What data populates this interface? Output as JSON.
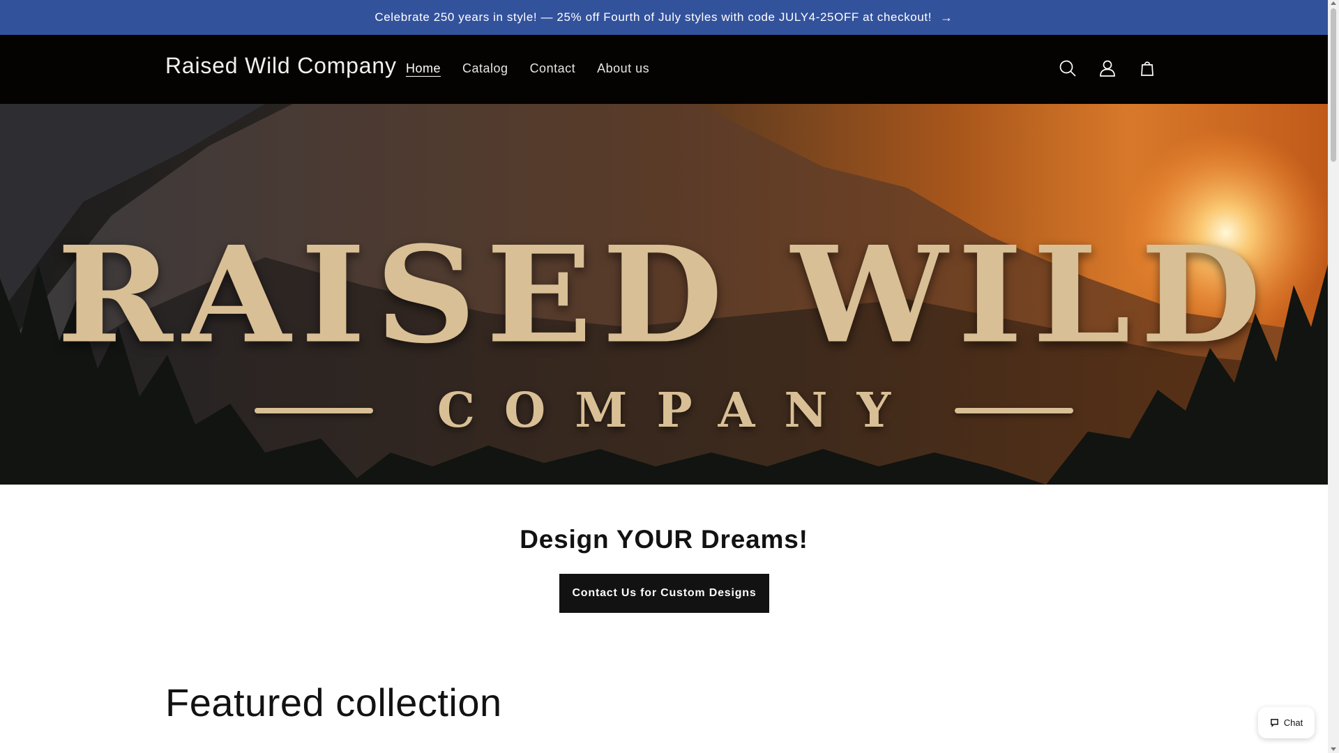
{
  "announcement": {
    "text": "Celebrate 250 years in style! — 25% off Fourth of July styles with code JULY4-25OFF at checkout!",
    "arrow_icon": "arrow-right-icon"
  },
  "header": {
    "store_name": "Raised Wild Company",
    "nav": [
      {
        "label": "Home",
        "active": true
      },
      {
        "label": "Catalog",
        "active": false
      },
      {
        "label": "Contact",
        "active": false
      },
      {
        "label": "About us",
        "active": false
      }
    ],
    "icons": [
      "search-icon",
      "account-icon",
      "cart-icon"
    ]
  },
  "hero": {
    "title": "RAISED WILD",
    "subtitle": "COMPANY"
  },
  "cta": {
    "heading": "Design YOUR Dreams!",
    "button_label": "Contact Us for Custom Designs"
  },
  "featured": {
    "heading": "Featured collection"
  },
  "chat": {
    "label": "Chat",
    "icon": "chat-bubble-icon"
  },
  "colors": {
    "announcement_bg": "#33529c",
    "header_bg": "#050202",
    "button_bg": "#121212",
    "hero_text": "#d9bf95"
  }
}
